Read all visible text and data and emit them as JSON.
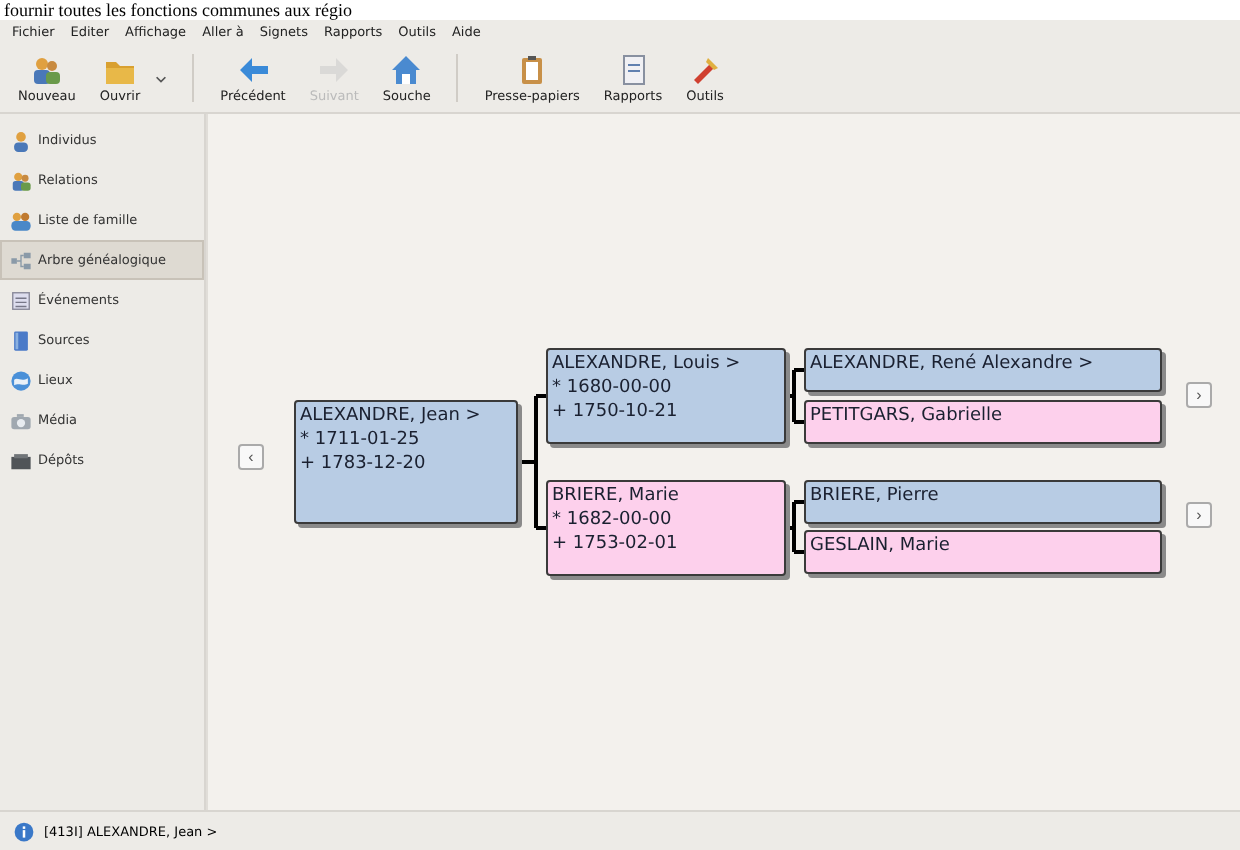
{
  "caption": "fournir toutes les fonctions communes aux régio",
  "menu": [
    "Fichier",
    "Editer",
    "Affichage",
    "Aller à",
    "Signets",
    "Rapports",
    "Outils",
    "Aide"
  ],
  "toolbar": [
    {
      "kind": "button",
      "label": "Nouveau",
      "disabled": false,
      "dropdown": false
    },
    {
      "kind": "button",
      "label": "Ouvrir",
      "disabled": false,
      "dropdown": true
    },
    {
      "kind": "separator"
    },
    {
      "kind": "button",
      "label": "Précédent",
      "disabled": false,
      "dropdown": false
    },
    {
      "kind": "button",
      "label": "Suivant",
      "disabled": true,
      "dropdown": false
    },
    {
      "kind": "button",
      "label": "Souche",
      "disabled": false,
      "dropdown": false
    },
    {
      "kind": "separator"
    },
    {
      "kind": "button",
      "label": "Presse-papiers",
      "disabled": false,
      "dropdown": false
    },
    {
      "kind": "button",
      "label": "Rapports",
      "disabled": false,
      "dropdown": false
    },
    {
      "kind": "button",
      "label": "Outils",
      "disabled": false,
      "dropdown": false
    }
  ],
  "sidebar": {
    "items": [
      {
        "label": "Individus",
        "selected": false
      },
      {
        "label": "Relations",
        "selected": false
      },
      {
        "label": "Liste de famille",
        "selected": false
      },
      {
        "label": "Arbre généalogique",
        "selected": true
      },
      {
        "label": "Événements",
        "selected": false
      },
      {
        "label": "Sources",
        "selected": false
      },
      {
        "label": "Lieux",
        "selected": false
      },
      {
        "label": "Média",
        "selected": false
      },
      {
        "label": "Dépôts",
        "selected": false
      }
    ]
  },
  "tree": {
    "persons": [
      {
        "kind": "male",
        "lines": [
          "ALEXANDRE, Jean >",
          "* 1711-01-25",
          "+ 1783-12-20"
        ]
      },
      {
        "kind": "male",
        "lines": [
          "ALEXANDRE, Louis >",
          "* 1680-00-00",
          "+ 1750-10-21"
        ]
      },
      {
        "kind": "female",
        "lines": [
          "BRIERE, Marie",
          "* 1682-00-00",
          "+ 1753-02-01"
        ]
      },
      {
        "kind": "male",
        "lines": [
          "ALEXANDRE, René Alexandre >"
        ]
      },
      {
        "kind": "female",
        "lines": [
          "PETITGARS, Gabrielle"
        ]
      },
      {
        "kind": "male",
        "lines": [
          "BRIERE, Pierre"
        ]
      },
      {
        "kind": "female",
        "lines": [
          "GESLAIN, Marie"
        ]
      }
    ],
    "back_button": "‹",
    "forward_buttons": [
      "›",
      "›"
    ]
  },
  "status_bar": "[413I] ALEXANDRE, Jean >"
}
